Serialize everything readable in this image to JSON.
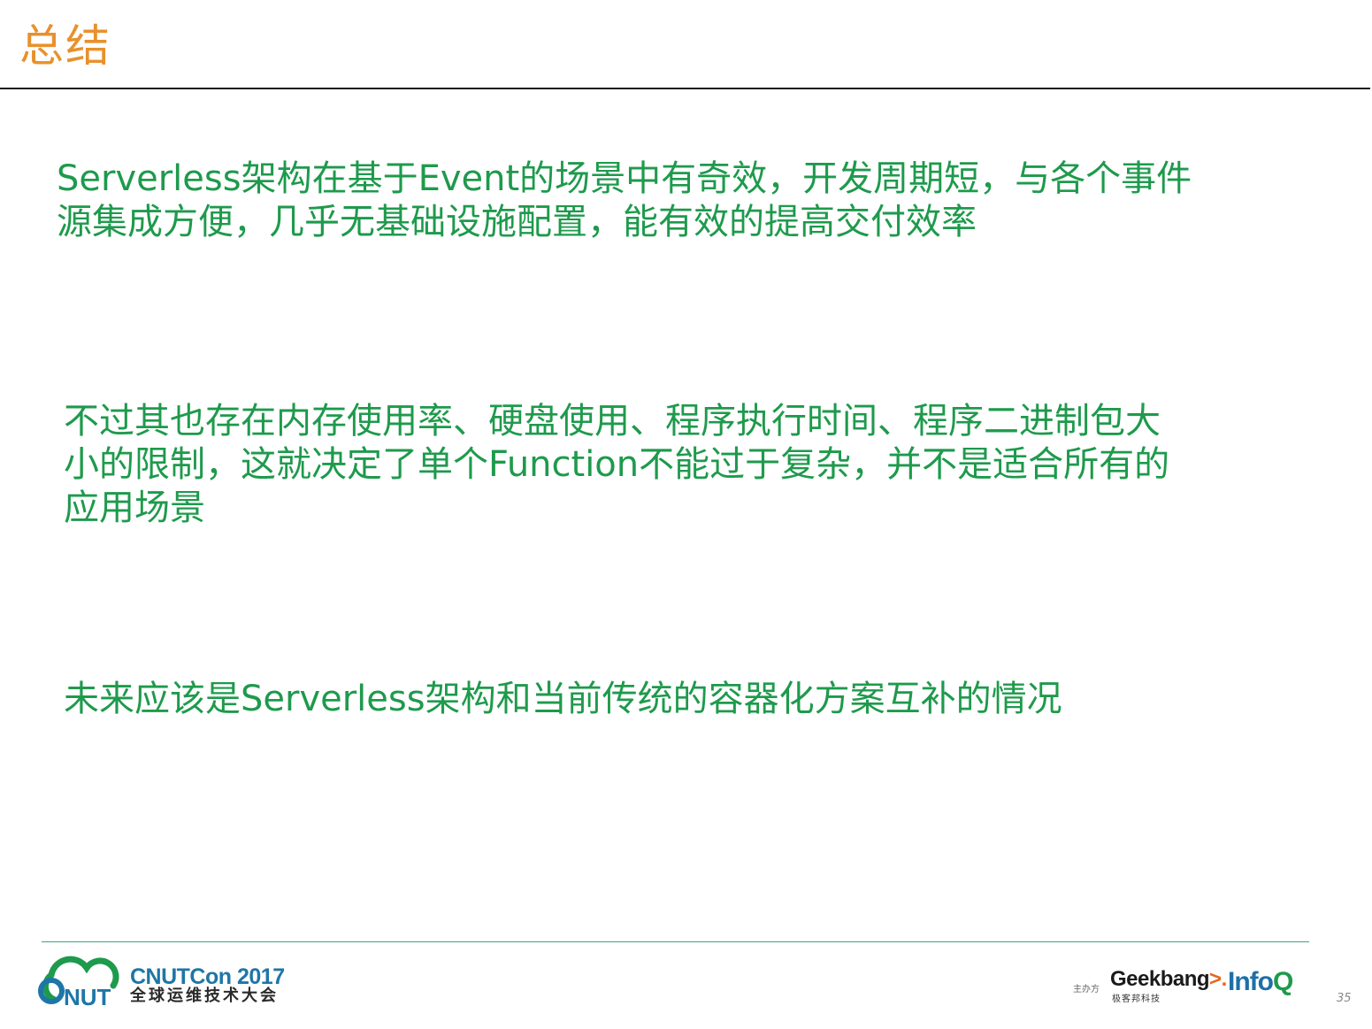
{
  "slide": {
    "title": "总结",
    "page_number": "35"
  },
  "bullets": [
    {
      "lines": [
        "Serverless架构在基于Event的场景中有奇效，开发周期短，与各个事件",
        "源集成方便，几乎无基础设施配置，能有效的提高交付效率"
      ]
    },
    {
      "lines": [
        "不过其也存在内存使用率、硬盘使用、程序执行时间、程序二进制包大",
        "小的限制，这就决定了单个Function不能过于复杂，并不是适合所有的",
        "应用场景"
      ]
    },
    {
      "lines": [
        "未来应该是Serverless架构和当前传统的容器化方案互补的情况"
      ]
    }
  ],
  "footer": {
    "conference_name": "CNUTCon",
    "conference_year": "2017",
    "conference_subtitle": "全球运维技术大会",
    "logo_text": "NUT",
    "host_label": "主办方",
    "geekbang_text": "Geekbang",
    "geekbang_arrow": ">.",
    "geekbang_subtitle": "极客邦科技",
    "infoq_text": "Info",
    "infoq_q": "Q"
  },
  "colors": {
    "title": "#e8912c",
    "body_text": "#1e9a4c",
    "conference_blue": "#1e76a7",
    "logo_green": "#1e9a4c",
    "infoq_blue": "#1e6fa8"
  }
}
